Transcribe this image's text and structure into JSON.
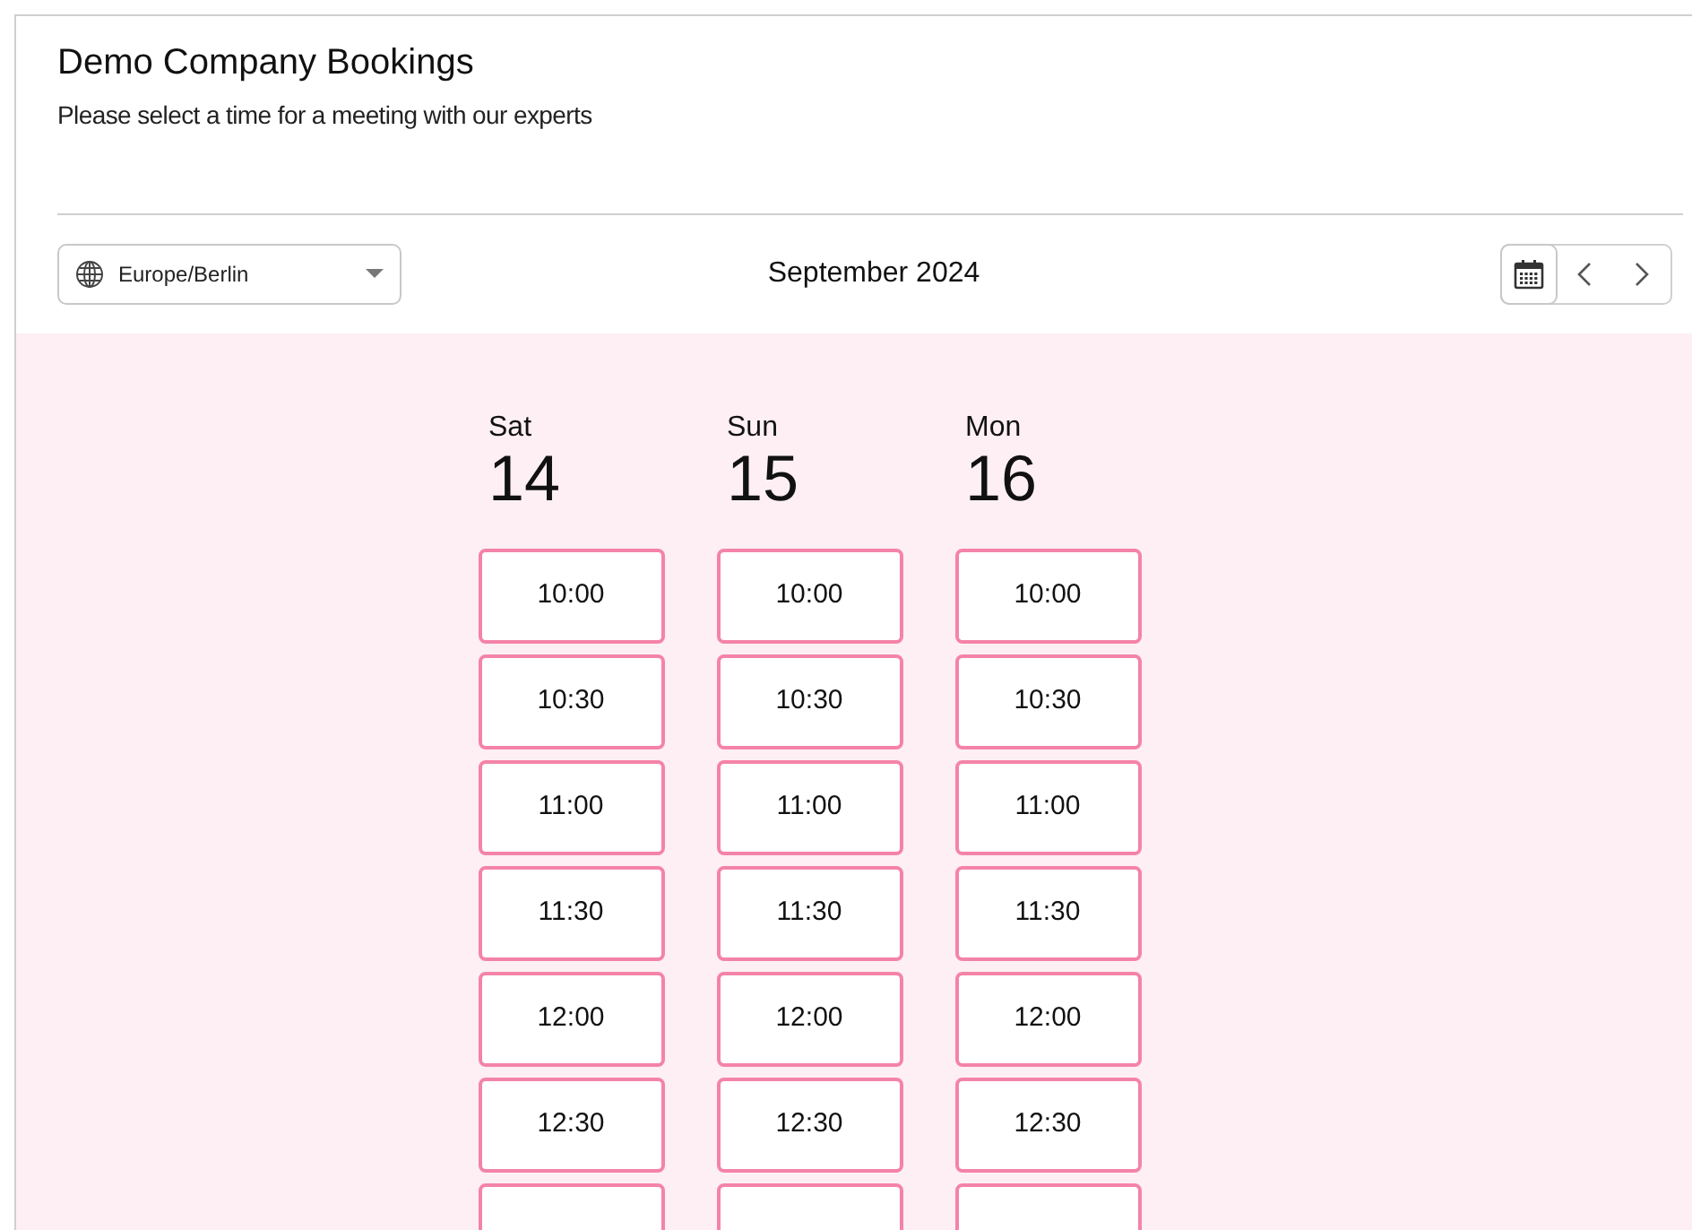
{
  "header": {
    "title": "Demo Company Bookings",
    "subtitle": "Please select a time for a meeting with our experts"
  },
  "toolbar": {
    "timezone": "Europe/Berlin",
    "month": "September 2024"
  },
  "days": [
    {
      "weekday": "Sat",
      "date": "14",
      "slots": [
        "10:00",
        "10:30",
        "11:00",
        "11:30",
        "12:00",
        "12:30"
      ]
    },
    {
      "weekday": "Sun",
      "date": "15",
      "slots": [
        "10:00",
        "10:30",
        "11:00",
        "11:30",
        "12:00",
        "12:30"
      ]
    },
    {
      "weekday": "Mon",
      "date": "16",
      "slots": [
        "10:00",
        "10:30",
        "11:00",
        "11:30",
        "12:00",
        "12:30"
      ]
    }
  ]
}
